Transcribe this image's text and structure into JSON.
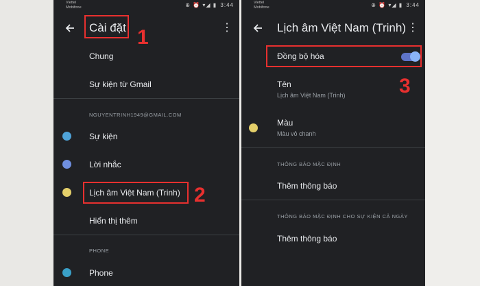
{
  "left": {
    "status": {
      "carrier_line1": "Viettel",
      "carrier_line2": "Mobifone",
      "icons": "⊕ ⏰ ▾◢ ▮",
      "time": "3:44"
    },
    "appbar": {
      "title": "Cài đặt"
    },
    "items": [
      {
        "label": "Chung"
      },
      {
        "label": "Sự kiện từ Gmail"
      }
    ],
    "account_section": "NGUYENTRINH1949@GMAIL.COM",
    "calendars": [
      {
        "label": "Sự kiện",
        "color": "#4fa3d9"
      },
      {
        "label": "Lời nhắc",
        "color": "#6f8fe0"
      },
      {
        "label": "Lịch âm Việt Nam (Trinh)",
        "color": "#e4cf6a"
      },
      {
        "label": "Hiển thị thêm"
      }
    ],
    "phone_section": "PHONE",
    "phone_item": {
      "label": "Phone",
      "color": "#3aa0c8"
    },
    "marks": {
      "one": "1",
      "two": "2"
    }
  },
  "right": {
    "status": {
      "carrier_line1": "Viettel",
      "carrier_line2": "Mobifone",
      "icons": "⊕ ⏰ ▾◢ ▮",
      "time": "3:44"
    },
    "appbar": {
      "title": "Lịch âm Việt Nam (Trinh)"
    },
    "sync": {
      "label": "Đồng bộ hóa",
      "enabled": true
    },
    "name": {
      "label": "Tên",
      "value": "Lịch âm Việt Nam (Trinh)"
    },
    "color": {
      "label": "Màu",
      "value": "Màu vỏ chanh",
      "hex": "#e4cf6a"
    },
    "default_notif_section": "THÔNG BÁO MẶC ĐỊNH",
    "add_notif_1": "Thêm thông báo",
    "allday_notif_section": "THÔNG BÁO MẶC ĐỊNH CHO SỰ KIỆN CẢ NGÀY",
    "add_notif_2": "Thêm thông báo",
    "marks": {
      "three": "3"
    }
  },
  "colors": {
    "accent_red": "#e8302f",
    "background": "#202124",
    "toggle": "#8ab4f8"
  }
}
